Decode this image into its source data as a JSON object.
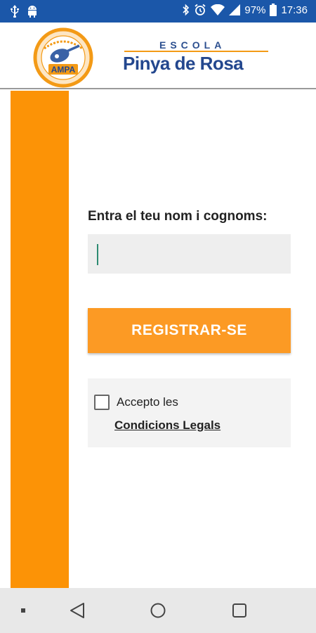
{
  "status_bar": {
    "left_icons": [
      "usb-icon",
      "android-icon"
    ],
    "right_icons": [
      "bluetooth-icon",
      "alarm-icon",
      "wifi-icon",
      "signal-icon",
      "battery-icon"
    ],
    "battery": "97%",
    "time": "17:36"
  },
  "header": {
    "ampa_logo_text": "AMPA",
    "school_label": "ESCOLA",
    "school_name": "Pinya de Rosa"
  },
  "form": {
    "prompt": "Entra el teu nom i cognoms:",
    "name_value": "",
    "register_label": "REGISTRAR-SE",
    "accept_label": "Accepto les",
    "legal_link": "Condicions Legals",
    "accepted": false
  },
  "colors": {
    "status_bar": "#1b57a9",
    "accent_orange": "#fc9306",
    "button_orange": "#fc9a24",
    "brand_blue": "#23478e"
  },
  "nav_bar": {
    "icons": [
      "recent-square-small-icon",
      "back-icon",
      "home-icon",
      "overview-icon"
    ]
  }
}
